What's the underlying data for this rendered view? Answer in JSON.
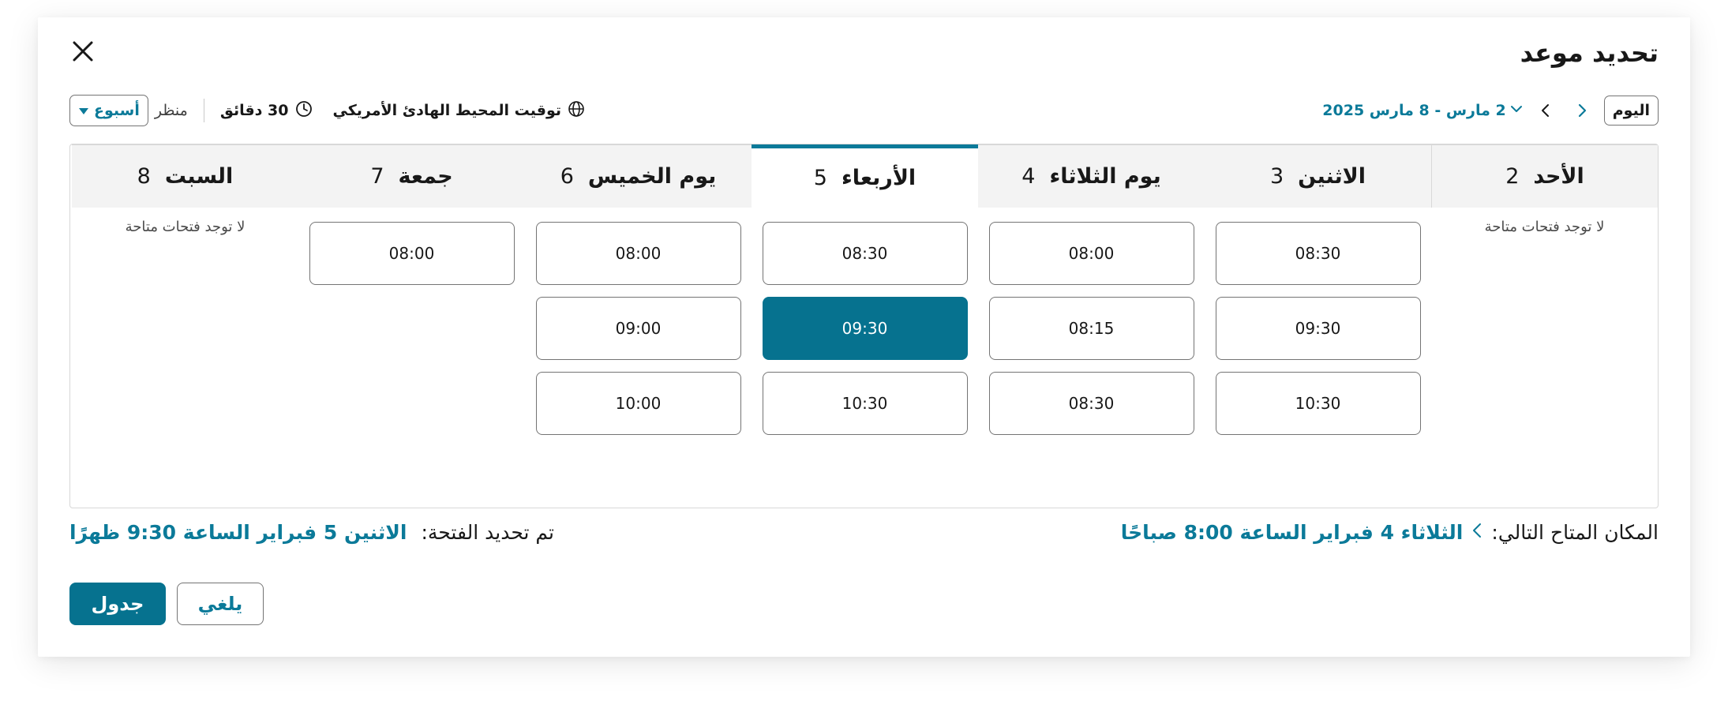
{
  "dialog": {
    "title": "تحديد موعد",
    "close_icon": "close-icon"
  },
  "toolbar": {
    "today_label": "اليوم",
    "date_range": "2 مارس - 8 مارس 2025",
    "timezone": "توقيت المحيط الهادئ الأمريكي",
    "duration": "30 دقائق",
    "view_label": "منظر",
    "view_value": "أسبوع",
    "icons": [
      "chevron-right-icon",
      "chevron-left-icon",
      "chevron-down-icon",
      "globe-icon",
      "clock-icon",
      "caret-down-icon"
    ]
  },
  "days": [
    {
      "name": "الأحد",
      "num": "2",
      "slots": [],
      "no_slots": "لا توجد فتحات متاحة"
    },
    {
      "name": "الاثنين",
      "num": "3",
      "slots": [
        "08:30",
        "09:30",
        "10:30"
      ]
    },
    {
      "name": "يوم الثلاثاء",
      "num": "4",
      "slots": [
        "08:00",
        "08:15",
        "08:30"
      ]
    },
    {
      "name": "الأربعاء",
      "num": "5",
      "slots": [
        "08:30",
        "09:30",
        "10:30"
      ],
      "selected": true,
      "selected_slot": "09:30"
    },
    {
      "name": "يوم الخميس",
      "num": "6",
      "slots": [
        "08:00",
        "09:00",
        "10:00"
      ]
    },
    {
      "name": "جمعة",
      "num": "7",
      "slots": [
        "08:00"
      ]
    },
    {
      "name": "السبت",
      "num": "8",
      "slots": [],
      "no_slots": "لا توجد فتحات متاحة"
    }
  ],
  "next_available": {
    "label": ":المكان المتاح التالي",
    "value": "الثلاثاء 4 فبراير الساعة 8:00 صباحًا"
  },
  "selected_info": {
    "label": ":تم تحديد الفتحة",
    "value": "الاثنين 5 فبراير الساعة 9:30 ظهرًا"
  },
  "actions": {
    "schedule_label": "جدول",
    "cancel_label": "يلغي"
  },
  "colors": {
    "accent": "#06728f",
    "link": "#0b7a99"
  }
}
